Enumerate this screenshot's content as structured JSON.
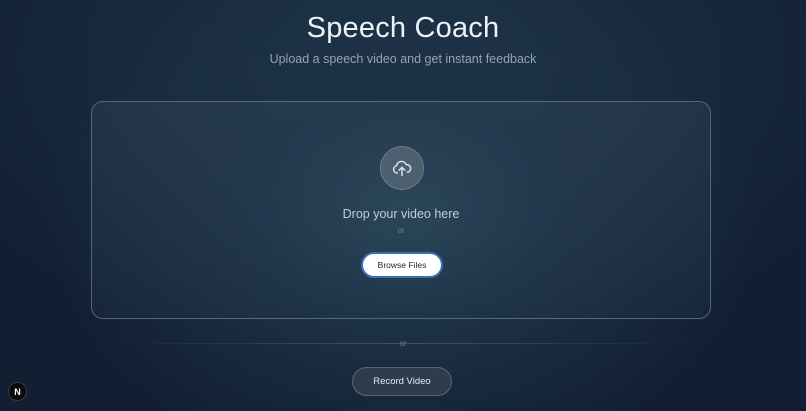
{
  "header": {
    "title": "Speech Coach",
    "subtitle": "Upload a speech video and get instant feedback"
  },
  "dropzone": {
    "icon": "cloud-upload-icon",
    "prompt": "Drop your video here",
    "or_label": "or",
    "browse_label": "Browse Files"
  },
  "divider": {
    "or_label": "or"
  },
  "record": {
    "label": "Record Video"
  },
  "dev_badge": {
    "letter": "N"
  },
  "colors": {
    "background": "#121f33",
    "browse_border": "#3c6fb3",
    "record_bg": "#2f3c4b"
  }
}
